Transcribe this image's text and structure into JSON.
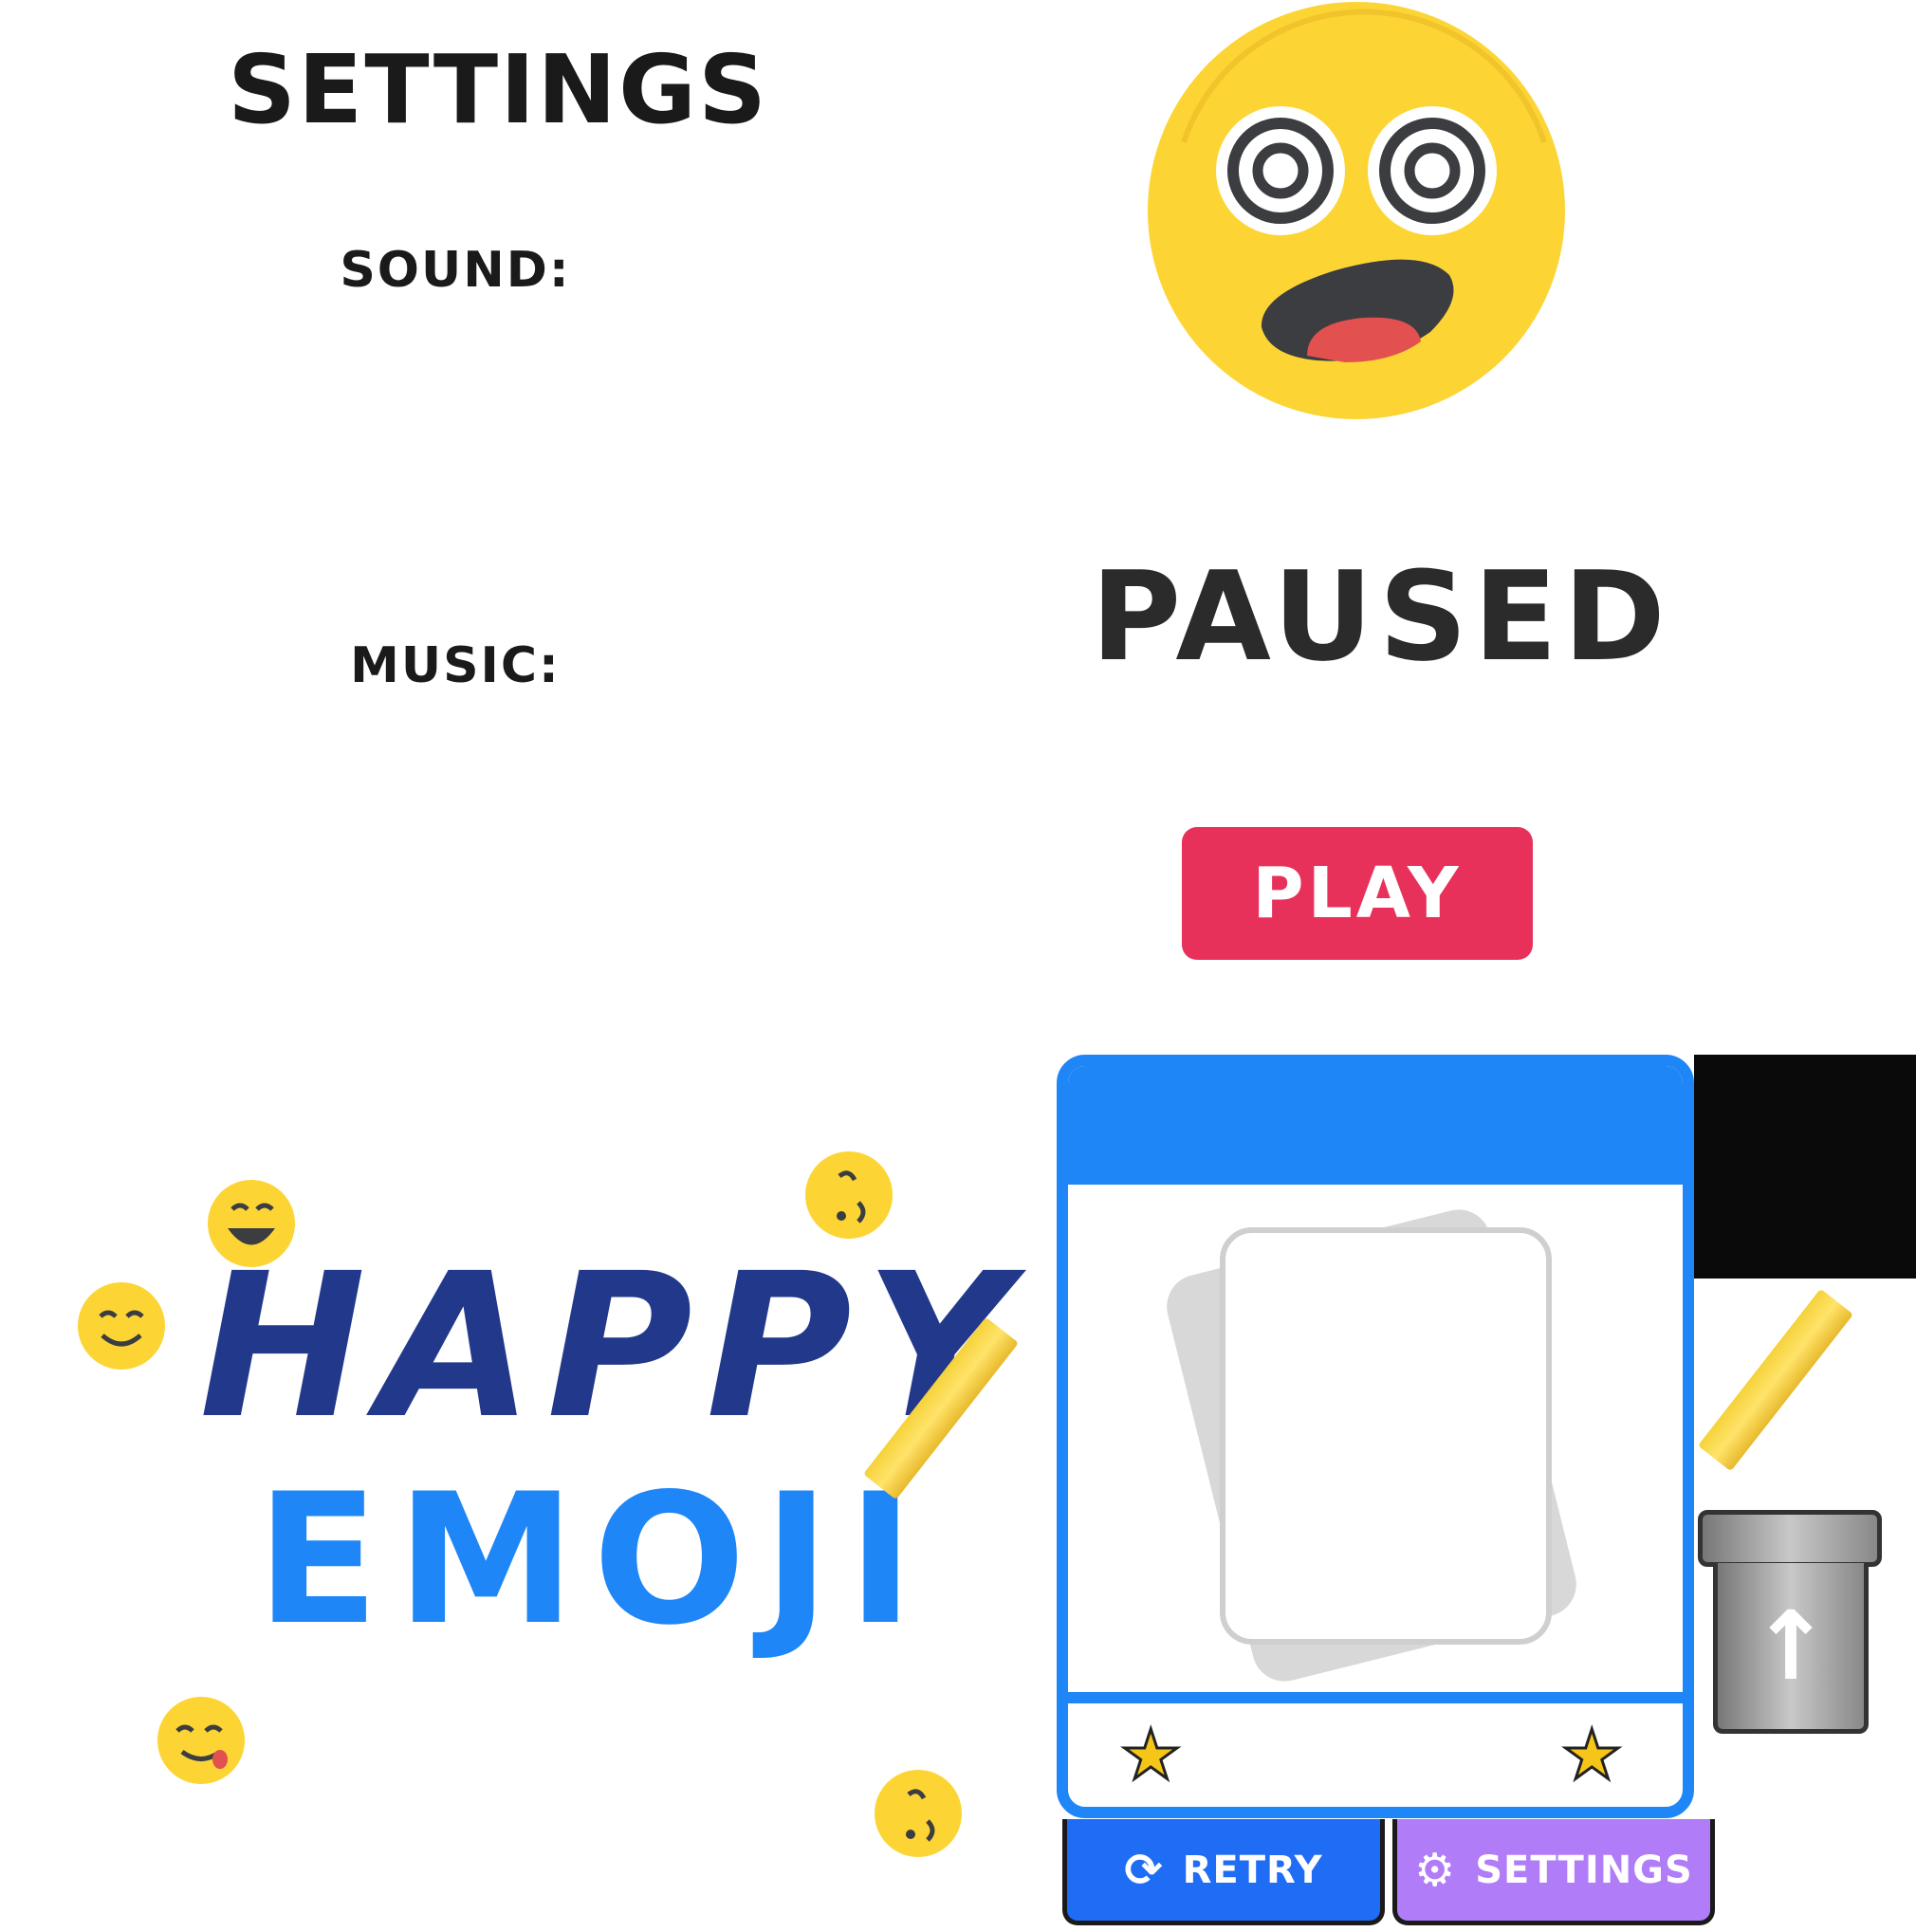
{
  "settings_panel": {
    "title": "SETTINGS",
    "sound_label": "SOUND:",
    "music_label": "MUSIC:"
  },
  "pause_panel": {
    "title": "PAUSED",
    "play_label": "PLAY",
    "emoji": "dizzy-face-emoji"
  },
  "logo": {
    "line1": "HAPPY",
    "line2": "EMOJI"
  },
  "game_card": {
    "stars": [
      "star-icon",
      "star-icon"
    ]
  },
  "bottom_tabs": {
    "retry_label": "RETRY",
    "settings_label": "SETTINGS"
  },
  "colors": {
    "play_button": "#e8315a",
    "card_border": "#1e86f7",
    "retry_tab": "#1f6cf5",
    "settings_tab": "#b07cf7",
    "logo_dark_blue": "#22388a",
    "logo_light_blue": "#1e86f7",
    "emoji_yellow": "#fcd535"
  }
}
